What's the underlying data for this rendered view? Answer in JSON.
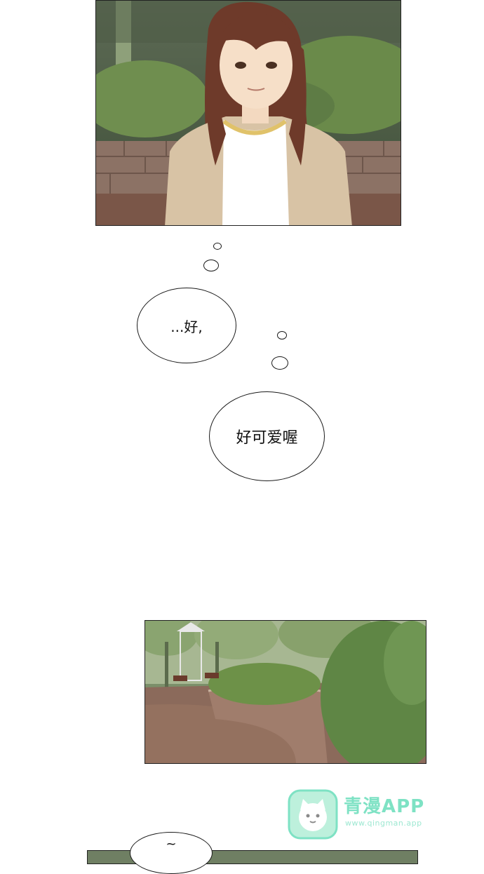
{
  "bubbles": {
    "first": "...好,",
    "second": "好可爱喔",
    "bottom": "~"
  },
  "watermark": {
    "brand": "青漫APP",
    "url": "www.qingman.app",
    "icon": "cat-icon",
    "color": "#7ee2c4"
  },
  "colors": {
    "cardigan": "#d8c3a5",
    "hair": "#6e3a2a",
    "foliage": "#5f7d47",
    "brick": "#8b6a5b"
  }
}
